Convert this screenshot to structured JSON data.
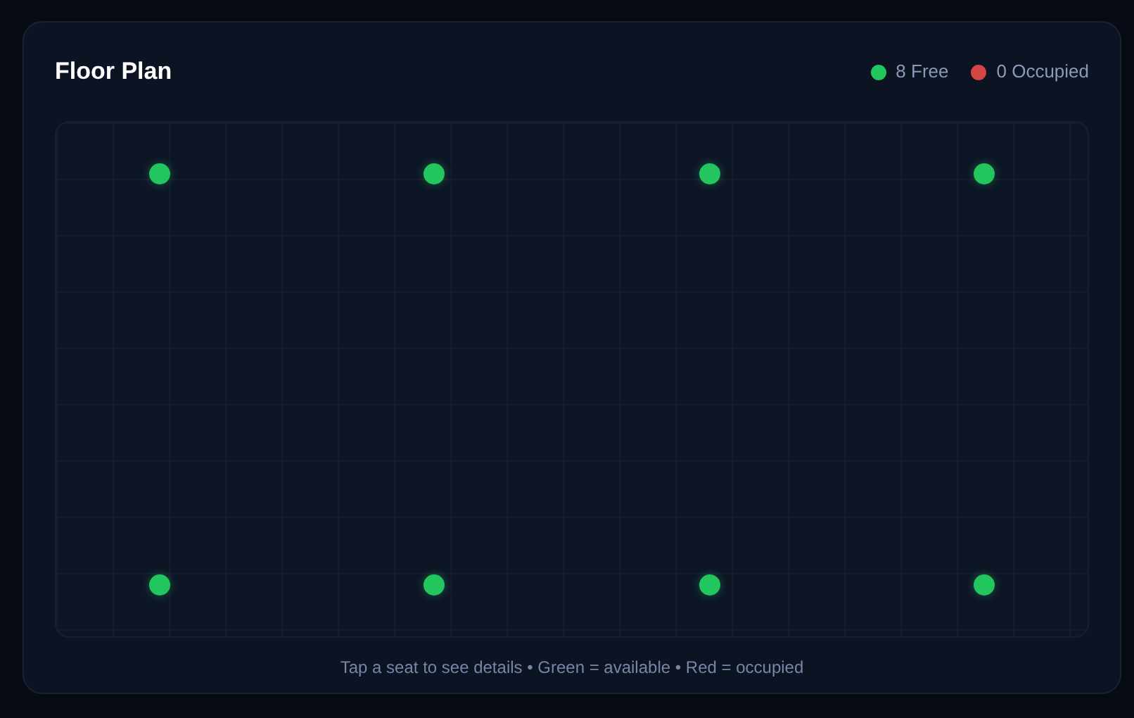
{
  "title": "Floor Plan",
  "legend": [
    {
      "label": "8 Free",
      "color": "#22c55e"
    },
    {
      "label": "0 Occupied",
      "color": "#d64545"
    }
  ],
  "seat_rows": [
    [
      {
        "occupied": false
      },
      {
        "occupied": false
      },
      {
        "occupied": false
      },
      {
        "occupied": false
      }
    ],
    [
      {
        "occupied": false
      },
      {
        "occupied": false
      },
      {
        "occupied": false
      },
      {
        "occupied": false
      }
    ]
  ],
  "hint": "Tap a seat to see details • Green = available • Red = occupied"
}
